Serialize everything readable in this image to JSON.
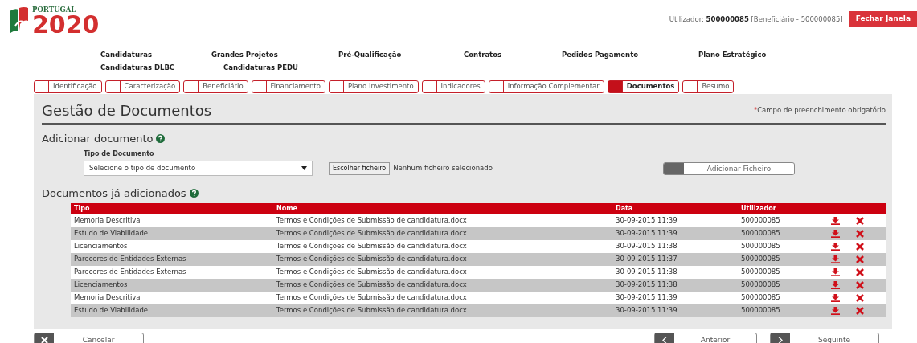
{
  "header": {
    "logo_top": "PORTUGAL",
    "logo_number": "2020",
    "user_label": "Utilizador:",
    "user_id": "500000085",
    "user_role": "[Beneficiário - 500000085]",
    "close_button": "Fechar Janela"
  },
  "menu_rows": [
    {
      "items": [
        "Candidaturas",
        "Grandes Projetos",
        "Pré-Qualificação",
        "Contratos",
        "Pedidos Pagamento",
        "Plano Estratégico"
      ]
    },
    {
      "items": [
        "Candidaturas DLBC",
        "Candidaturas PEDU"
      ]
    }
  ],
  "tabs": [
    {
      "label": "Identificação",
      "selected": false
    },
    {
      "label": "Caracterização",
      "selected": false
    },
    {
      "label": "Beneficiário",
      "selected": false
    },
    {
      "label": "Financiamento",
      "selected": false
    },
    {
      "label": "Plano Investimento",
      "selected": false
    },
    {
      "label": "Indicadores",
      "selected": false
    },
    {
      "label": "Informação Complementar",
      "selected": false
    },
    {
      "label": "Documentos",
      "selected": true
    },
    {
      "label": "Resumo",
      "selected": false
    }
  ],
  "page_title": "Gestão de Documentos",
  "required_mark": "*",
  "required_note": "Campo de preenchimento obrigatório",
  "add_section": {
    "heading": "Adicionar documento",
    "field_label": "Tipo de Documento",
    "select_placeholder": "Selecione o tipo de documento",
    "file_button": "Escolher ficheiro",
    "file_status": "Nenhum ficheiro selecionado",
    "add_button": "Adicionar Ficheiro"
  },
  "documents": {
    "heading": "Documentos já adicionados",
    "columns": [
      "Tipo",
      "Nome",
      "Data",
      "Utilizador"
    ],
    "rows": [
      {
        "tipo": "Memoria Descritiva",
        "nome": "Termos e Condições de Submissão de candidatura.docx",
        "data": "30-09-2015 11:39",
        "utilizador": "500000085"
      },
      {
        "tipo": "Estudo de Viabilidade",
        "nome": "Termos e Condições de Submissão de candidatura.docx",
        "data": "30-09-2015 11:39",
        "utilizador": "500000085"
      },
      {
        "tipo": "Licenciamentos",
        "nome": "Termos e Condições de Submissão de candidatura.docx",
        "data": "30-09-2015 11:38",
        "utilizador": "500000085"
      },
      {
        "tipo": "Pareceres de Entidades Externas",
        "nome": "Termos e Condições de Submissão de candidatura.docx",
        "data": "30-09-2015 11:37",
        "utilizador": "500000085"
      },
      {
        "tipo": "Pareceres de Entidades Externas",
        "nome": "Termos e Condições de Submissão de candidatura.docx",
        "data": "30-09-2015 11:38",
        "utilizador": "500000085"
      },
      {
        "tipo": "Licenciamentos",
        "nome": "Termos e Condições de Submissão de candidatura.docx",
        "data": "30-09-2015 11:38",
        "utilizador": "500000085"
      },
      {
        "tipo": "Memoria Descritiva",
        "nome": "Termos e Condições de Submissão de candidatura.docx",
        "data": "30-09-2015 11:39",
        "utilizador": "500000085"
      },
      {
        "tipo": "Estudo de Viabilidade",
        "nome": "Termos e Condições de Submissão de candidatura.docx",
        "data": "30-09-2015 11:39",
        "utilizador": "500000085"
      }
    ]
  },
  "footer": {
    "cancel": "Cancelar",
    "previous": "Anterior",
    "next": "Seguinte"
  }
}
